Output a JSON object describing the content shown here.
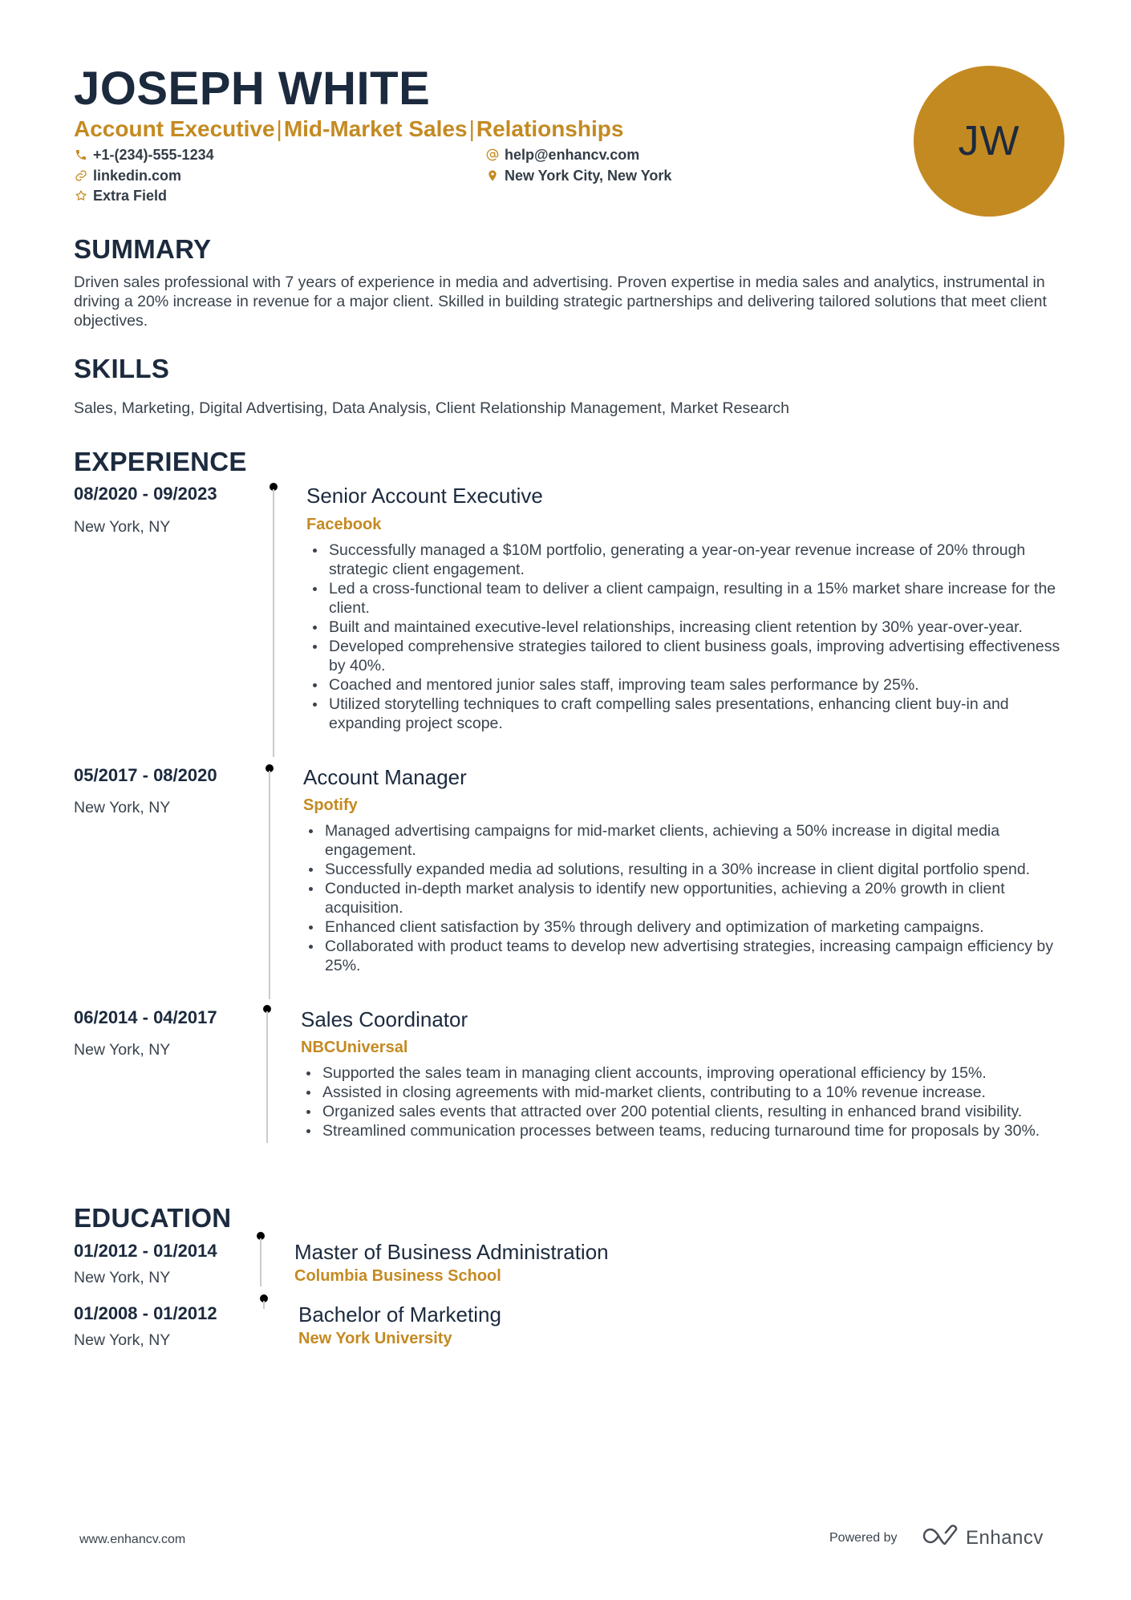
{
  "header": {
    "name": "JOSEPH WHITE",
    "title_parts": [
      "Account Executive",
      "Mid-Market Sales",
      "Relationships"
    ],
    "separator": "|",
    "avatar_initials": "JW",
    "contacts": {
      "phone": {
        "icon": "phone-icon",
        "text": "+1-(234)-555-1234"
      },
      "email": {
        "icon": "at-icon",
        "text": "help@enhancv.com"
      },
      "linkedin": {
        "icon": "link-icon",
        "text": "linkedin.com"
      },
      "location": {
        "icon": "map-pin-icon",
        "text": "New York City, New York"
      },
      "extra": {
        "icon": "star-icon",
        "text": "Extra Field"
      }
    }
  },
  "colors": {
    "accent": "#c48a22",
    "heading": "#1c2a3e",
    "body": "#3a434d"
  },
  "summary": {
    "heading": "SUMMARY",
    "text": "Driven sales professional with 7 years of experience in media and advertising. Proven expertise in media sales and analytics, instrumental in driving a 20% increase in revenue for a major client. Skilled in building strategic partnerships and delivering tailored solutions that meet client objectives."
  },
  "skills": {
    "heading": "SKILLS",
    "text": "Sales, Marketing, Digital Advertising, Data Analysis, Client Relationship Management, Market Research"
  },
  "experience": {
    "heading": "EXPERIENCE",
    "jobs": [
      {
        "dates": "08/2020 - 09/2023",
        "location": "New York, NY",
        "title": "Senior Account Executive",
        "company": "Facebook",
        "bullets": [
          "Successfully managed a $10M portfolio, generating a year-on-year revenue increase of 20% through strategic client engagement.",
          "Led a cross-functional team to deliver a client campaign, resulting in a 15% market share increase for the client.",
          "Built and maintained executive-level relationships, increasing client retention by 30% year-over-year.",
          "Developed comprehensive strategies tailored to client business goals, improving advertising effectiveness by 40%.",
          "Coached and mentored junior sales staff, improving team sales performance by 25%.",
          "Utilized storytelling techniques to craft compelling sales presentations, enhancing client buy-in and expanding project scope."
        ]
      },
      {
        "dates": "05/2017 - 08/2020",
        "location": "New York, NY",
        "title": "Account Manager",
        "company": "Spotify",
        "bullets": [
          "Managed advertising campaigns for mid-market clients, achieving a 50% increase in digital media engagement.",
          "Successfully expanded media ad solutions, resulting in a 30% increase in client digital portfolio spend.",
          "Conducted in-depth market analysis to identify new opportunities, achieving a 20% growth in client acquisition.",
          "Enhanced client satisfaction by 35% through delivery and optimization of marketing campaigns.",
          "Collaborated with product teams to develop new advertising strategies, increasing campaign efficiency by 25%."
        ]
      },
      {
        "dates": "06/2014 - 04/2017",
        "location": "New York, NY",
        "title": "Sales Coordinator",
        "company": "NBCUniversal",
        "bullets": [
          "Supported the sales team in managing client accounts, improving operational efficiency by 15%.",
          "Assisted in closing agreements with mid-market clients, contributing to a 10% revenue increase.",
          "Organized sales events that attracted over 200 potential clients, resulting in enhanced brand visibility.",
          "Streamlined communication processes between teams, reducing turnaround time for proposals by 30%."
        ]
      }
    ]
  },
  "education": {
    "heading": "EDUCATION",
    "items": [
      {
        "dates": "01/2012 - 01/2014",
        "location": "New York, NY",
        "degree": "Master of Business Administration",
        "school": "Columbia Business School"
      },
      {
        "dates": "01/2008 - 01/2012",
        "location": "New York, NY",
        "degree": "Bachelor of Marketing",
        "school": "New York University"
      }
    ]
  },
  "footer": {
    "website": "www.enhancv.com",
    "powered_by": "Powered by",
    "brand": "Enhancv",
    "brand_icon": "enhancv-logo-icon"
  }
}
